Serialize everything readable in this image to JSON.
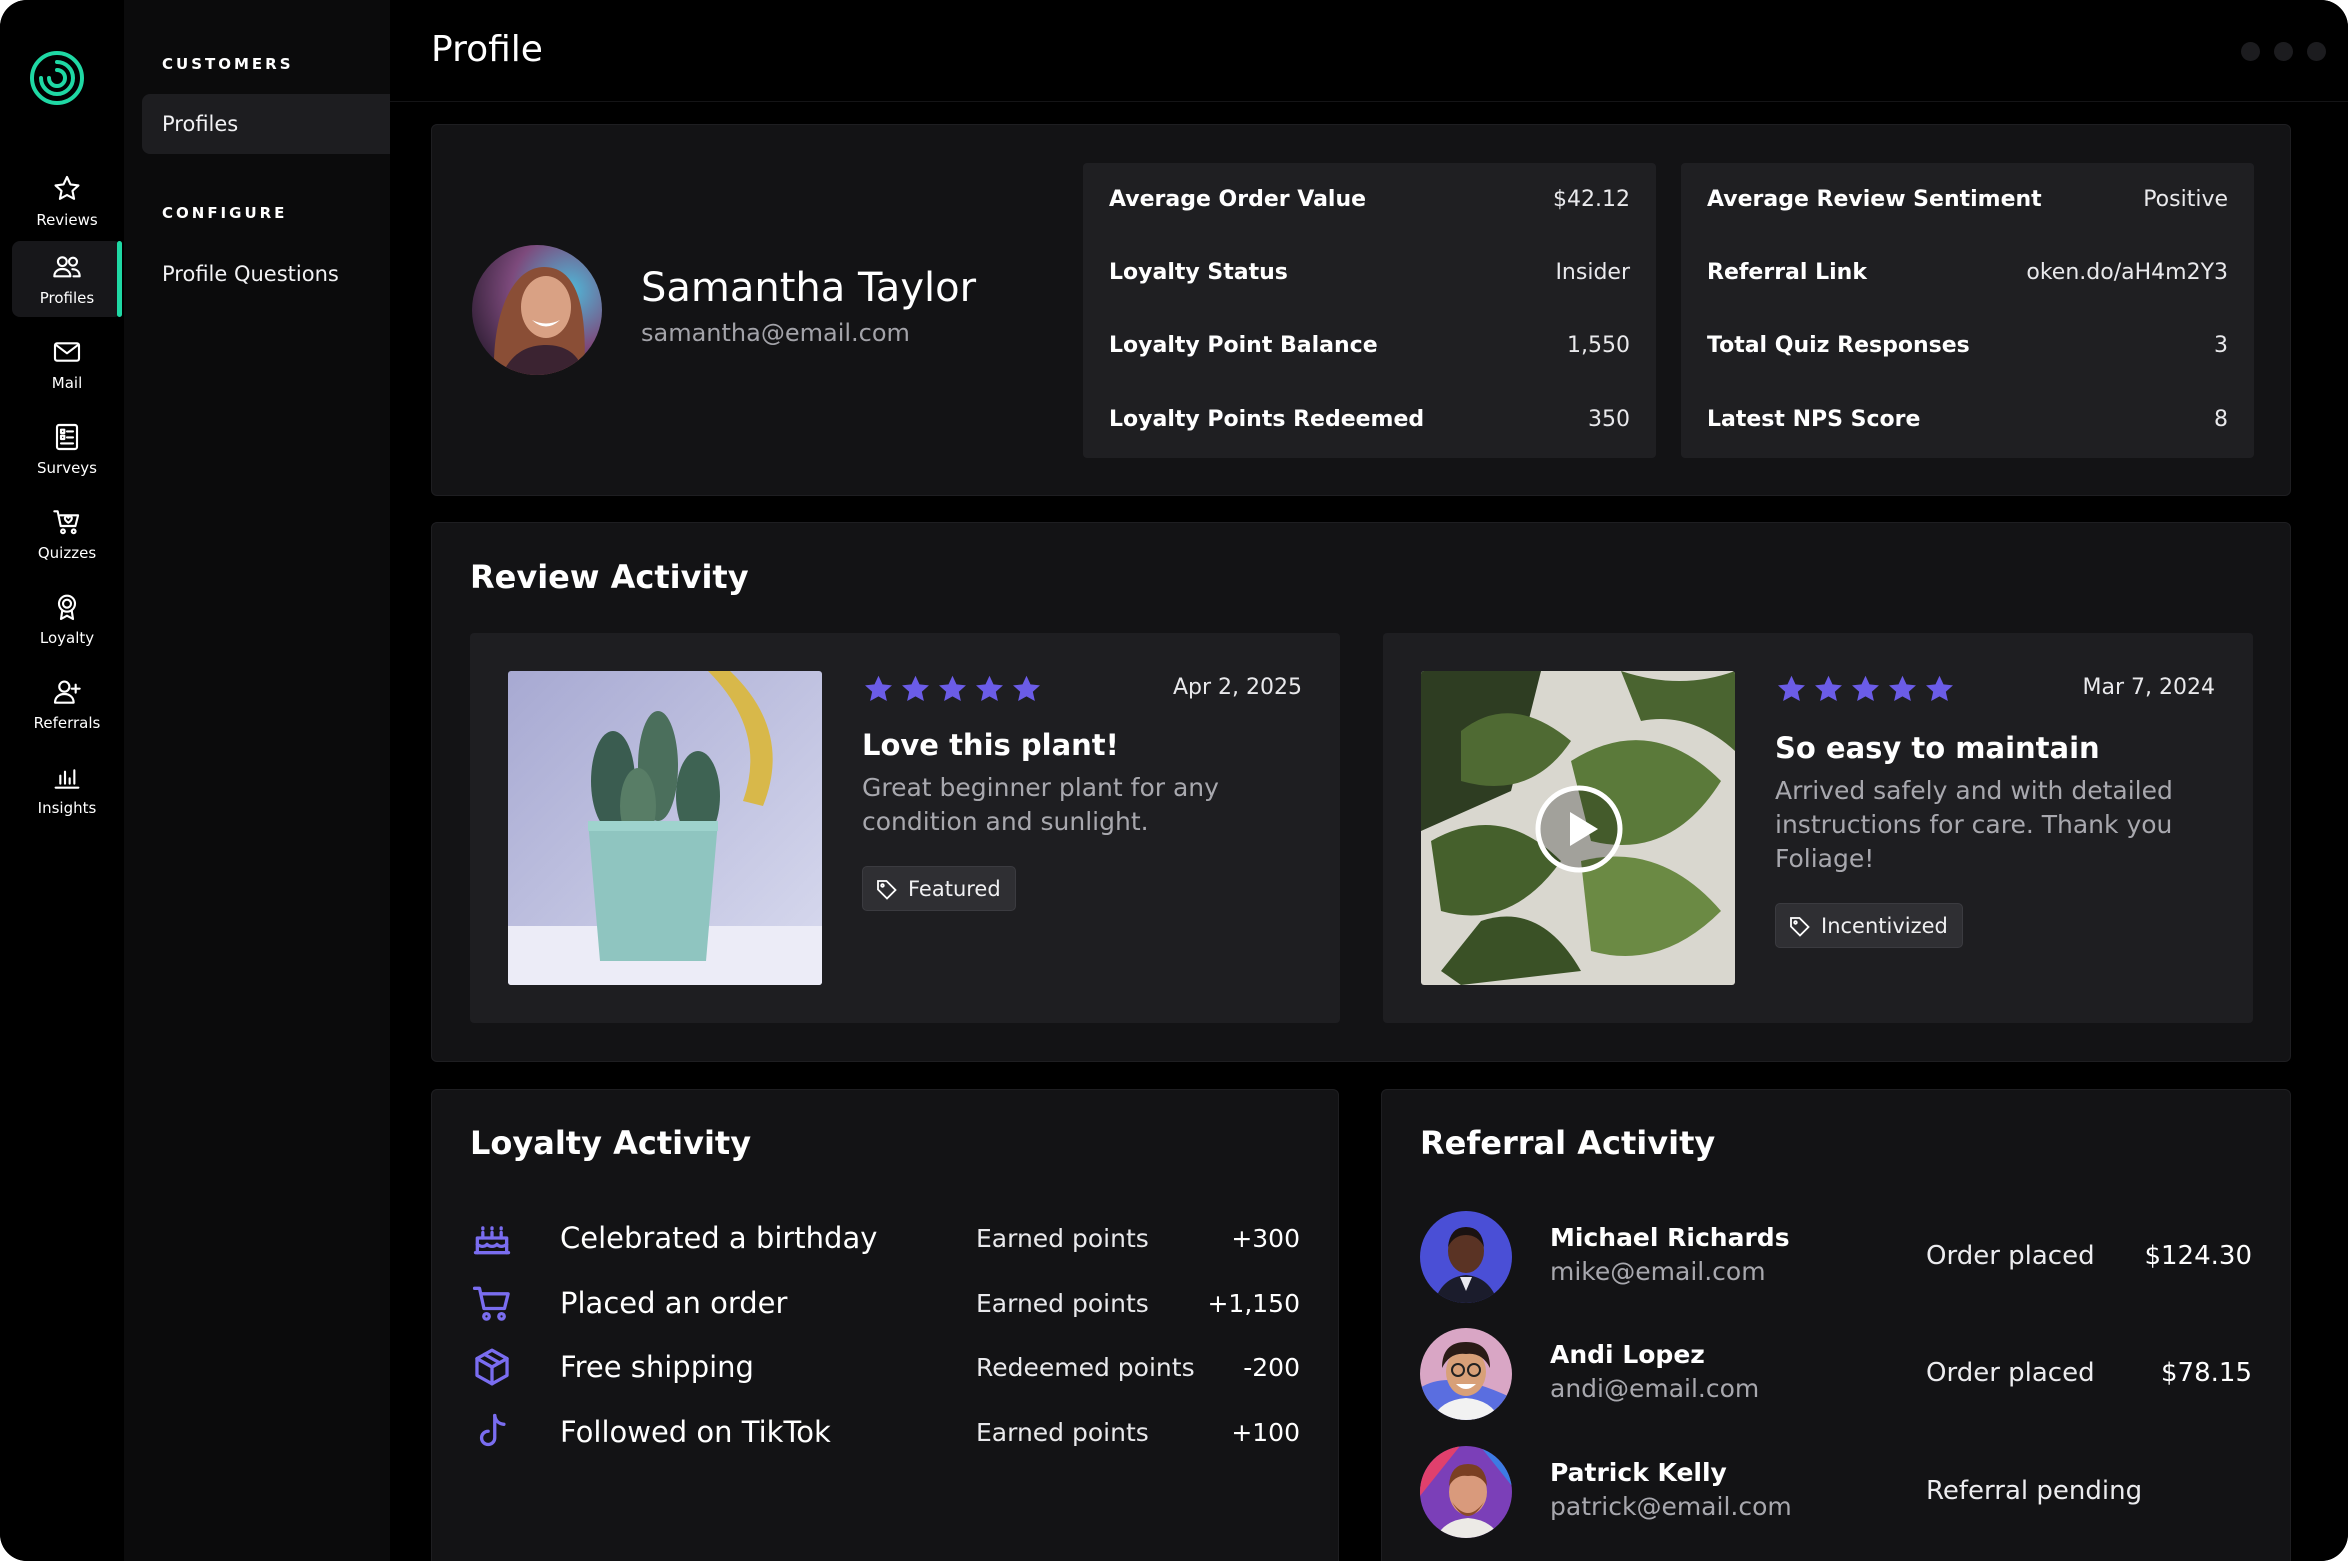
{
  "sidebar": {
    "logo": "brand-logo",
    "items": [
      {
        "label": "Reviews",
        "icon": "star-icon"
      },
      {
        "label": "Profiles",
        "icon": "users-icon",
        "active": true
      },
      {
        "label": "Mail",
        "icon": "mail-icon"
      },
      {
        "label": "Surveys",
        "icon": "survey-icon"
      },
      {
        "label": "Quizzes",
        "icon": "cart-heart-icon"
      },
      {
        "label": "Loyalty",
        "icon": "award-icon"
      },
      {
        "label": "Referrals",
        "icon": "user-plus-icon"
      },
      {
        "label": "Insights",
        "icon": "bar-chart-icon"
      }
    ]
  },
  "subnav": {
    "customers_heading": "CUSTOMERS",
    "profiles": "Profiles",
    "configure_heading": "CONFIGURE",
    "profile_questions": "Profile Questions"
  },
  "header": {
    "title": "Profile"
  },
  "profile": {
    "name": "Samantha Taylor",
    "email": "samantha@email.com",
    "stats_left": [
      {
        "label": "Average Order Value",
        "value": "$42.12"
      },
      {
        "label": "Loyalty Status",
        "value": "Insider"
      },
      {
        "label": "Loyalty Point Balance",
        "value": "1,550"
      },
      {
        "label": "Loyalty Points Redeemed",
        "value": "350"
      }
    ],
    "stats_right": [
      {
        "label": "Average Review Sentiment",
        "value": "Positive"
      },
      {
        "label": "Referral Link",
        "value": "oken.do/aH4m2Y3"
      },
      {
        "label": "Total Quiz Responses",
        "value": "3"
      },
      {
        "label": "Latest NPS Score",
        "value": "8"
      }
    ]
  },
  "review_activity": {
    "title": "Review Activity",
    "reviews": [
      {
        "rating": 5,
        "date": "Apr 2, 2025",
        "title": "Love this plant!",
        "body": "Great beginner plant for any condition and sunlight.",
        "tag": "Featured",
        "media": "photo"
      },
      {
        "rating": 5,
        "date": "Mar 7, 2024",
        "title": "So easy to maintain",
        "body": "Arrived safely and with detailed instructions for care. Thank you Foliage!",
        "tag": "Incentivized",
        "media": "video"
      }
    ]
  },
  "loyalty_activity": {
    "title": "Loyalty Activity",
    "items": [
      {
        "icon": "birthday-cake-icon",
        "label": "Celebrated a birthday",
        "kind": "Earned points",
        "points": "+300"
      },
      {
        "icon": "cart-icon",
        "label": "Placed an order",
        "kind": "Earned points",
        "points": "+1,150"
      },
      {
        "icon": "box-icon",
        "label": "Free shipping",
        "kind": "Redeemed points",
        "points": "-200"
      },
      {
        "icon": "tiktok-icon",
        "label": "Followed on TikTok",
        "kind": "Earned points",
        "points": "+100"
      }
    ]
  },
  "referral_activity": {
    "title": "Referral Activity",
    "items": [
      {
        "name": "Michael Richards",
        "email": "mike@email.com",
        "status": "Order placed",
        "amount": "$124.30"
      },
      {
        "name": "Andi Lopez",
        "email": "andi@email.com",
        "status": "Order placed",
        "amount": "$78.15"
      },
      {
        "name": "Patrick Kelly",
        "email": "patrick@email.com",
        "status": "Referral pending",
        "amount": ""
      }
    ]
  },
  "colors": {
    "accent": "#1fd8a4",
    "star": "#6b5ce7",
    "icon_purple": "#7a6df0",
    "background": "#000000",
    "card": "#131315"
  }
}
